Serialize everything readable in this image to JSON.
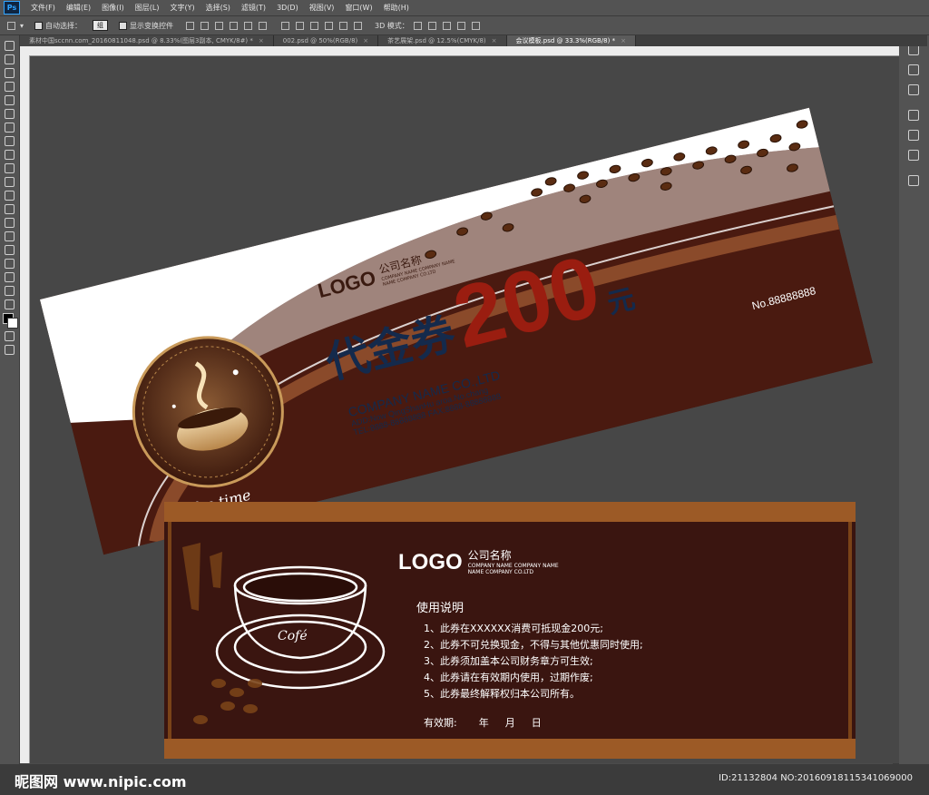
{
  "app": {
    "logo": "Ps"
  },
  "menu": [
    "文件(F)",
    "编辑(E)",
    "图像(I)",
    "图层(L)",
    "文字(Y)",
    "选择(S)",
    "滤镜(T)",
    "3D(D)",
    "视图(V)",
    "窗口(W)",
    "帮助(H)"
  ],
  "options": {
    "auto_select": "自动选择：",
    "auto_select_value": "组",
    "show_transform": "显示变换控件",
    "mode_3d": "3D 模式："
  },
  "tabs": [
    {
      "label": "素材中国sccnn.com_20160811048.psd @ 8.33%(图层3副本, CMYK/8#) *",
      "active": false
    },
    {
      "label": "002.psd @ 50%(RGB/8)",
      "active": false
    },
    {
      "label": "茶艺展架.psd @ 12.5%(CMYK/8)",
      "active": false
    },
    {
      "label": "会议模板.psd @ 33.3%(RGB/8) *",
      "active": true
    }
  ],
  "voucher_front": {
    "logo": "LOGO",
    "company_cn": "公司名称",
    "company_sub1": "COMPANY NAME COMPANY NAME",
    "company_sub2": "NAME COMPANY CO.LTD",
    "title": "代金券",
    "amount": "200",
    "unit": "元",
    "serial": "No.88888888",
    "company_en": "COMPANY NAME CO.,LTD",
    "address": "ADD:Now QingShanHu aroa.No.chang",
    "contact": "TEL:8888-88888888   FAX:8888-88888888",
    "tagline": "Coffee time"
  },
  "voucher_back": {
    "logo": "LOGO",
    "company_cn": "公司名称",
    "company_sub1": "COMPANY NAME COMPANY NAME",
    "company_sub2": "NAME COMPANY CO.LTD",
    "cup_text": "Cofé",
    "instructions_title": "使用说明",
    "rules": [
      "1、此券在XXXXXX消费可抵现金200元;",
      "2、此券不可兑换现金，不得与其他优惠同时使用;",
      "3、此券须加盖本公司财务章方可生效;",
      "4、此券请在有效期内使用，过期作废;",
      "5、此券最终解释权归本公司所有。"
    ],
    "validity_label": "有效期:",
    "year": "年",
    "month": "月",
    "day": "日"
  },
  "watermark": {
    "site": "昵图网 www.nipic.com",
    "id": "ID:21132804 NO:20160918115341069000"
  },
  "colors": {
    "brown_dark": "#4a1a10",
    "brown_back": "#3a1510",
    "red_amount": "#9a1d10",
    "navy_title": "#142a4c",
    "wood": "#9c5a26"
  }
}
